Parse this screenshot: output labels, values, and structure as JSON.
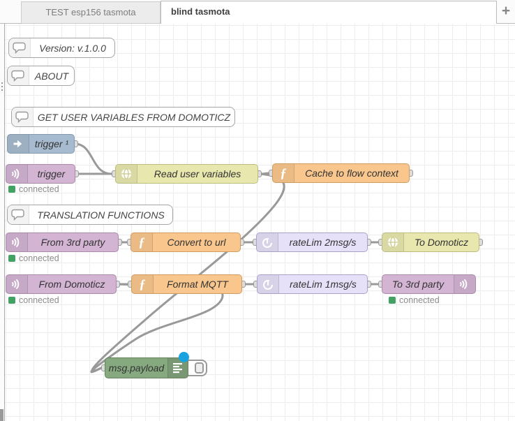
{
  "tabs": {
    "inactive": "TEST esp156 tasmota",
    "active": "blind tasmota",
    "add_label": "+"
  },
  "comments": {
    "version": "Version: v.1.0.0",
    "about": "ABOUT",
    "get_user": "GET USER VARIABLES FROM DOMOTICZ",
    "translation": "TRANSLATION FUNCTIONS"
  },
  "nodes": {
    "trigger1": "trigger ¹",
    "trigger": "trigger",
    "read_user": "Read user variables",
    "cache": "Cache to flow context",
    "from_3rd": "From 3rd party",
    "convert": "Convert to url",
    "ratelim2": "rateLim 2msg/s",
    "to_domoticz": "To Domoticz",
    "from_domoticz": "From Domoticz",
    "format_mqtt": "Format MQTT",
    "ratelim1": "rateLim 1msg/s",
    "to_3rd": "To 3rd party",
    "debug": "msg.payload"
  },
  "status": {
    "connected": "connected"
  },
  "icons": {
    "comment": "speech-bubble",
    "inject": "arrow-right",
    "mqtt": "broadcast-waves",
    "http_request": "globe",
    "function": "italic-f",
    "delay": "timer",
    "debug": "list-lines"
  },
  "colors": {
    "inject": "#a6bbcf",
    "mqtt": "#d3b4d3",
    "http_request": "#e7e7ae",
    "function": "#f9c78e",
    "delay": "#e6e0f8",
    "debug": "#87a980",
    "wire": "#999999",
    "status_connected": "#43a163",
    "debug_indicator": "#18a3e0"
  }
}
